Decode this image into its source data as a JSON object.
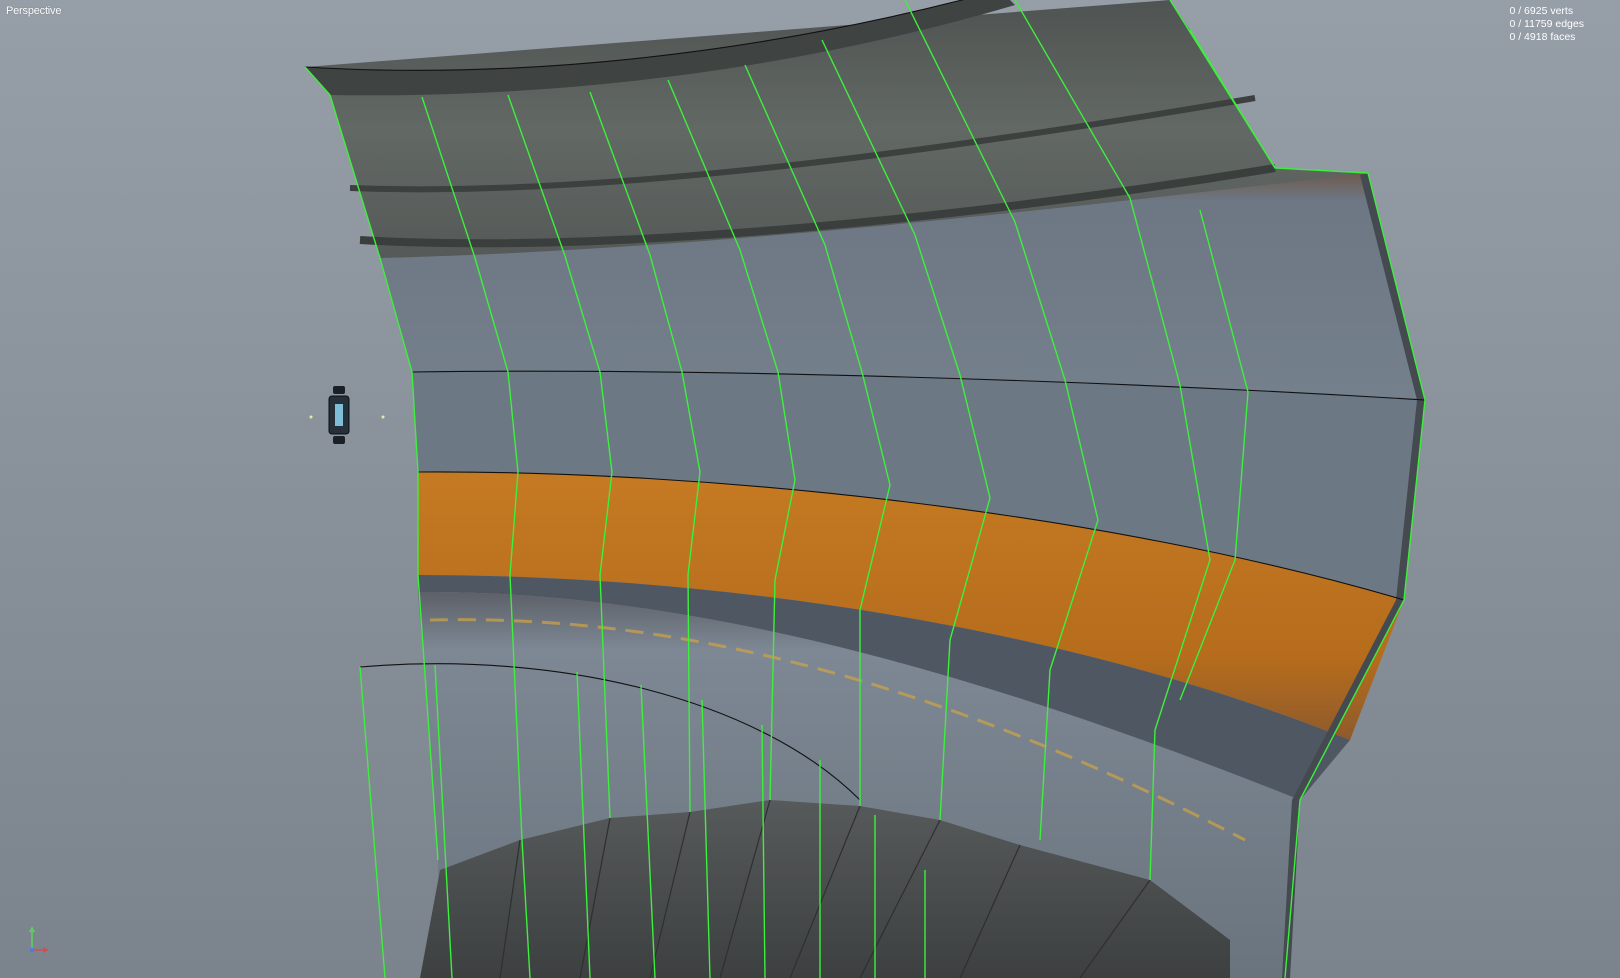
{
  "viewport": {
    "label": "Perspective"
  },
  "stats": {
    "verts": "0 / 6925 verts",
    "edges": "0 / 11759 edges",
    "faces": "0 / 4918 faces"
  },
  "icons": {
    "axis": "axis-gizmo-icon",
    "entity": "light-entity-icon"
  },
  "colors": {
    "background": "#8a929c",
    "wireframe": "#33ee33",
    "concrete": "#6f7a86",
    "orange_band": "#c8781c",
    "ceiling": "#5b605e",
    "stairs": "#4a4d4f"
  }
}
